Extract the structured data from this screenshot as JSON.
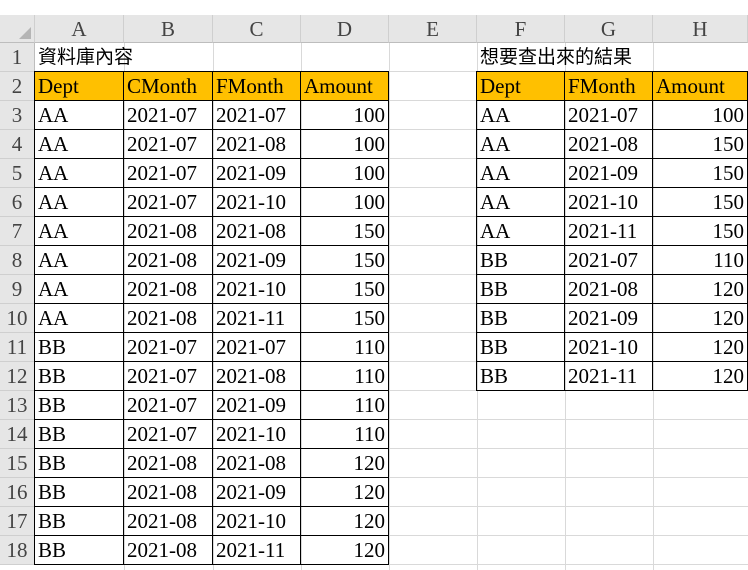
{
  "columns": [
    "A",
    "B",
    "C",
    "D",
    "E",
    "F",
    "G",
    "H"
  ],
  "rows": [
    "1",
    "2",
    "3",
    "4",
    "5",
    "6",
    "7",
    "8",
    "9",
    "10",
    "11",
    "12",
    "13",
    "14",
    "15",
    "16",
    "17",
    "18"
  ],
  "left_table": {
    "title": "資料庫內容",
    "headers": [
      "Dept",
      "CMonth",
      "FMonth",
      "Amount"
    ],
    "rows": [
      [
        "AA",
        "2021-07",
        "2021-07",
        "100"
      ],
      [
        "AA",
        "2021-07",
        "2021-08",
        "100"
      ],
      [
        "AA",
        "2021-07",
        "2021-09",
        "100"
      ],
      [
        "AA",
        "2021-07",
        "2021-10",
        "100"
      ],
      [
        "AA",
        "2021-08",
        "2021-08",
        "150"
      ],
      [
        "AA",
        "2021-08",
        "2021-09",
        "150"
      ],
      [
        "AA",
        "2021-08",
        "2021-10",
        "150"
      ],
      [
        "AA",
        "2021-08",
        "2021-11",
        "150"
      ],
      [
        "BB",
        "2021-07",
        "2021-07",
        "110"
      ],
      [
        "BB",
        "2021-07",
        "2021-08",
        "110"
      ],
      [
        "BB",
        "2021-07",
        "2021-09",
        "110"
      ],
      [
        "BB",
        "2021-07",
        "2021-10",
        "110"
      ],
      [
        "BB",
        "2021-08",
        "2021-08",
        "120"
      ],
      [
        "BB",
        "2021-08",
        "2021-09",
        "120"
      ],
      [
        "BB",
        "2021-08",
        "2021-10",
        "120"
      ],
      [
        "BB",
        "2021-08",
        "2021-11",
        "120"
      ]
    ]
  },
  "right_table": {
    "title": "想要查出來的結果",
    "headers": [
      "Dept",
      "FMonth",
      "Amount"
    ],
    "rows": [
      [
        "AA",
        "2021-07",
        "100"
      ],
      [
        "AA",
        "2021-08",
        "150"
      ],
      [
        "AA",
        "2021-09",
        "150"
      ],
      [
        "AA",
        "2021-10",
        "150"
      ],
      [
        "AA",
        "2021-11",
        "150"
      ],
      [
        "BB",
        "2021-07",
        "110"
      ],
      [
        "BB",
        "2021-08",
        "120"
      ],
      [
        "BB",
        "2021-09",
        "120"
      ],
      [
        "BB",
        "2021-10",
        "120"
      ],
      [
        "BB",
        "2021-11",
        "120"
      ]
    ]
  },
  "colors": {
    "header_fill": "#ffc000",
    "gridline": "#d9d9d9",
    "headings_bg": "#e6e6e6"
  }
}
